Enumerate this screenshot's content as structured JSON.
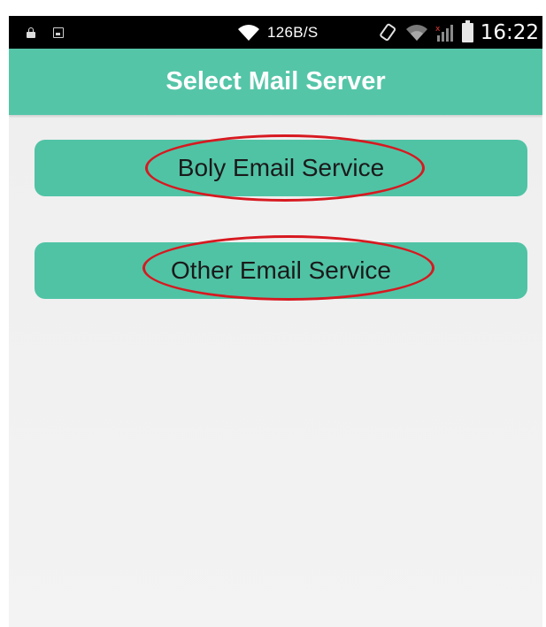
{
  "status_bar": {
    "net_speed": "126B/S",
    "time": "16:22",
    "icons": [
      "lock-icon",
      "image-icon",
      "wifi-icon",
      "rotate-icon",
      "wifi-dim-icon",
      "signal-icon",
      "battery-icon"
    ]
  },
  "header": {
    "title": "Select Mail Server",
    "color": "#55c5a8"
  },
  "services": [
    {
      "label": "Boly Email Service",
      "highlighted": true
    },
    {
      "label": "Other Email Service",
      "highlighted": true
    }
  ],
  "colors": {
    "accent": "#55c5a8",
    "highlight_oval": "#d71920",
    "background": "#efefef"
  }
}
